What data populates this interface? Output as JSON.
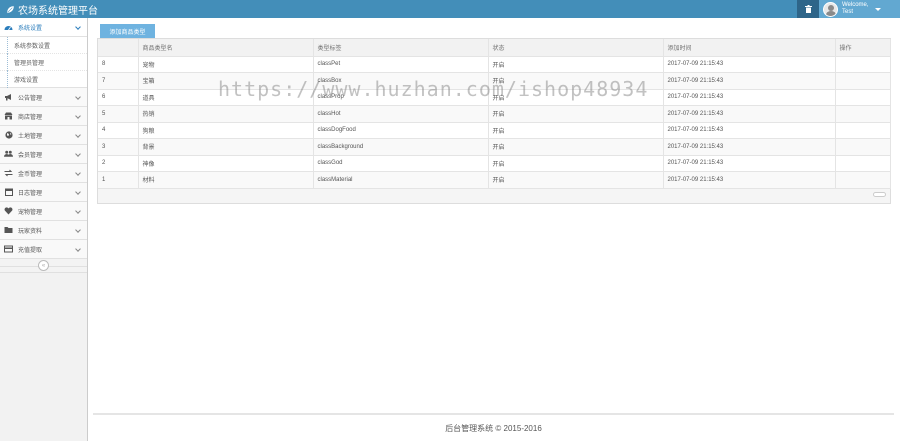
{
  "header": {
    "title": "农场系统管理平台",
    "brand_icon": "leaf-icon",
    "welcome": "Welcome,",
    "username": "Test",
    "trash_icon": "trash-icon"
  },
  "sidebar": {
    "items": [
      {
        "label": "系统设置",
        "icon": "dashboard-icon",
        "active": true,
        "children": [
          "系统参数设置",
          "管理员管理",
          "游戏设置"
        ]
      },
      {
        "label": "公告管理",
        "icon": "bullhorn-icon"
      },
      {
        "label": "商店管理",
        "icon": "store-icon"
      },
      {
        "label": "土地管理",
        "icon": "globe-icon"
      },
      {
        "label": "会员管理",
        "icon": "users-icon"
      },
      {
        "label": "金币管理",
        "icon": "exchange-icon"
      },
      {
        "label": "日志管理",
        "icon": "calendar-icon"
      },
      {
        "label": "宠物管理",
        "icon": "heart-icon"
      },
      {
        "label": "玩家资料",
        "icon": "folder-icon"
      },
      {
        "label": "充值提取",
        "icon": "card-icon"
      }
    ],
    "collapse_glyph": "«"
  },
  "toolbar": {
    "add_label": "添加商品类型"
  },
  "table": {
    "columns": [
      "",
      "商品类型名",
      "类型标签",
      "状态",
      "添加时间",
      "操作"
    ],
    "rows": [
      {
        "id": "8",
        "name": "宠物",
        "tag": "classPet",
        "status": "开启",
        "time": "2017-07-09 21:15:43"
      },
      {
        "id": "7",
        "name": "宝箱",
        "tag": "classBox",
        "status": "开启",
        "time": "2017-07-09 21:15:43"
      },
      {
        "id": "6",
        "name": "道具",
        "tag": "classProp",
        "status": "开启",
        "time": "2017-07-09 21:15:43"
      },
      {
        "id": "5",
        "name": "热销",
        "tag": "classHot",
        "status": "开启",
        "time": "2017-07-09 21:15:43"
      },
      {
        "id": "4",
        "name": "狗粮",
        "tag": "classDogFood",
        "status": "开启",
        "time": "2017-07-09 21:15:43"
      },
      {
        "id": "3",
        "name": "背景",
        "tag": "classBackground",
        "status": "开启",
        "time": "2017-07-09 21:15:43"
      },
      {
        "id": "2",
        "name": "神像",
        "tag": "classGod",
        "status": "开启",
        "time": "2017-07-09 21:15:43"
      },
      {
        "id": "1",
        "name": "材料",
        "tag": "classMaterial",
        "status": "开启",
        "time": "2017-07-09 21:15:43"
      }
    ]
  },
  "footer": {
    "text": "后台管理系统 © 2015-2016"
  },
  "watermark": "https://www.huzhan.com/ishop48934",
  "colors": {
    "header": "#438eb9",
    "user_box": "#62a8d1",
    "button": "#6fb3e0",
    "active_nav": "#2b7dbc"
  }
}
